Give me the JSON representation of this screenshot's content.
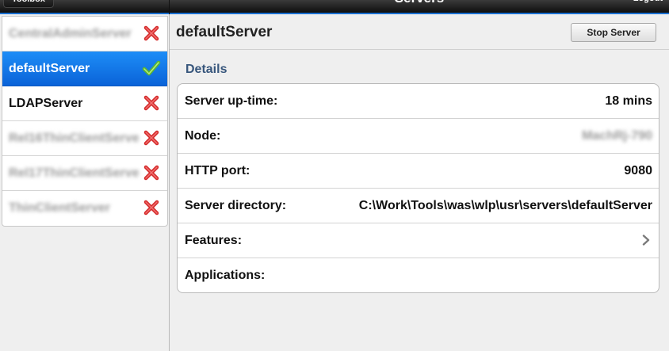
{
  "header": {
    "left_button": "Toolbox",
    "title": "Servers",
    "right_button": "Logout"
  },
  "sidebar": {
    "servers": [
      {
        "name": "CentralAdminServer",
        "status": "stopped",
        "blurred": true
      },
      {
        "name": "defaultServer",
        "status": "running",
        "selected": true
      },
      {
        "name": "LDAPServer",
        "status": "stopped"
      },
      {
        "name": "Rel16ThinClientServer",
        "status": "stopped",
        "blurred": true
      },
      {
        "name": "Rel17ThinClientServer",
        "status": "stopped",
        "blurred": true
      },
      {
        "name": "ThinClientServer",
        "status": "stopped",
        "blurred": true
      }
    ]
  },
  "main": {
    "title": "defaultServer",
    "stop_button": "Stop Server",
    "section_label": "Details",
    "details": [
      {
        "label": "Server up-time:",
        "value": "18 mins"
      },
      {
        "label": "Node:",
        "value": "MachRj-790",
        "blurred": true
      },
      {
        "label": "HTTP port:",
        "value": "9080"
      },
      {
        "label": "Server directory:",
        "value": "C:\\Work\\Tools\\was\\wlp\\usr\\servers\\defaultServer"
      },
      {
        "label": "Features:",
        "value": "",
        "chevron": true
      },
      {
        "label": "Applications:",
        "value": ""
      }
    ]
  },
  "colors": {
    "selection": "#1178e8",
    "accent_bar": "#1a6fd0",
    "section_label": "#37567c",
    "stopped": "#d42a2a",
    "running": "#5cb82c"
  }
}
